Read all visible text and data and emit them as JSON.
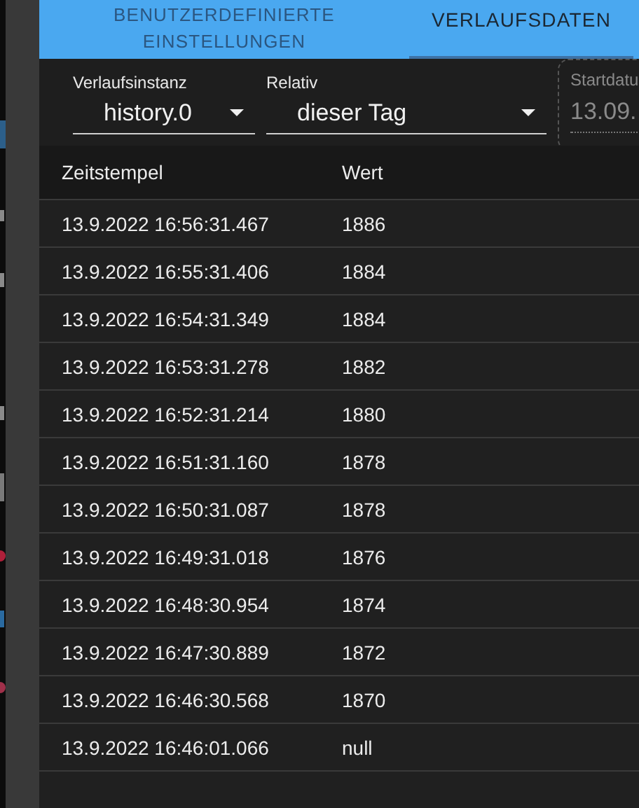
{
  "tabs": [
    {
      "label": "BENUTZERDEFINIERTE EINSTELLUNGEN",
      "selected": false
    },
    {
      "label": "VERLAUFSDATEN",
      "selected": true
    }
  ],
  "filters": [
    {
      "kind": "select",
      "label": "Verlaufsinstanz",
      "value": "history.0"
    },
    {
      "kind": "select",
      "label": "Relativ",
      "value": "dieser Tag"
    },
    {
      "kind": "date",
      "label": "Startdatu",
      "value": "13.09.",
      "disabled": true
    }
  ],
  "table": {
    "columns": [
      "Zeitstempel",
      "Wert"
    ],
    "rows": [
      [
        "13.9.2022 16:56:31.467",
        "1886"
      ],
      [
        "13.9.2022 16:55:31.406",
        "1884"
      ],
      [
        "13.9.2022 16:54:31.349",
        "1884"
      ],
      [
        "13.9.2022 16:53:31.278",
        "1882"
      ],
      [
        "13.9.2022 16:52:31.214",
        "1880"
      ],
      [
        "13.9.2022 16:51:31.160",
        "1878"
      ],
      [
        "13.9.2022 16:50:31.087",
        "1878"
      ],
      [
        "13.9.2022 16:49:31.018",
        "1876"
      ],
      [
        "13.9.2022 16:48:30.954",
        "1874"
      ],
      [
        "13.9.2022 16:47:30.889",
        "1872"
      ],
      [
        "13.9.2022 16:46:30.568",
        "1870"
      ],
      [
        "13.9.2022 16:46:01.066",
        "null"
      ]
    ]
  }
}
